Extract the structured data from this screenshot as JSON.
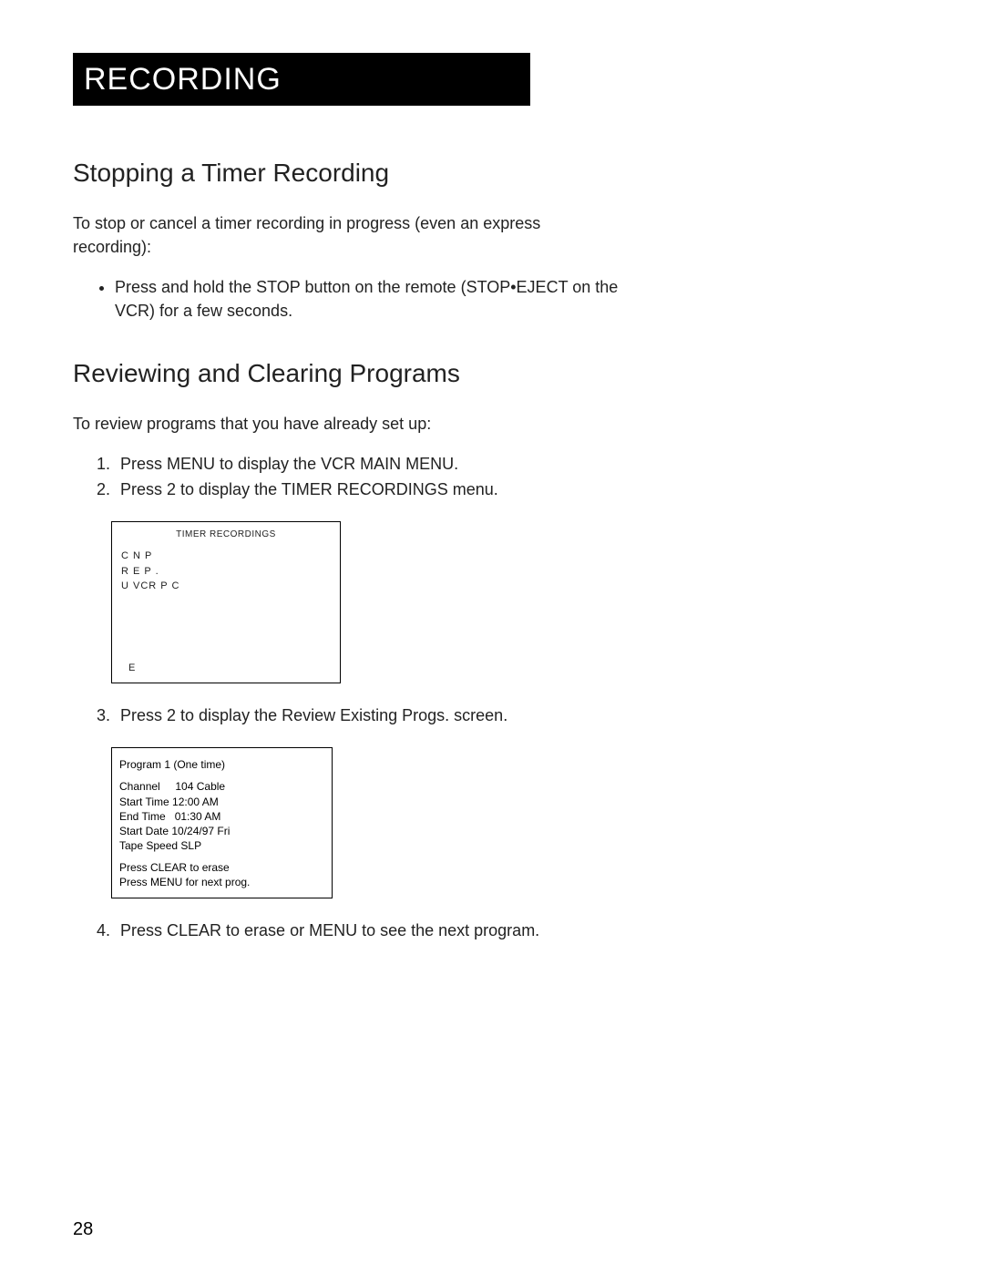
{
  "header": {
    "title": "RECORDING"
  },
  "section1": {
    "title": "Stopping a Timer Recording",
    "intro": "To stop or cancel a timer recording in progress (even an express recording):",
    "bullet1": "Press and hold the STOP button on the remote (STOP•EJECT on the VCR) for a few seconds."
  },
  "section2": {
    "title": "Reviewing and Clearing Programs",
    "intro": "To review programs that you have already set up:",
    "step1": "Press MENU to display the VCR MAIN MENU.",
    "step2": "Press 2 to display the TIMER RECORDINGS menu.",
    "step3": "Press 2 to display the Review Existing Progs. screen.",
    "step4": "Press CLEAR to erase or MENU to see the next program."
  },
  "timer_screen": {
    "title": "TIMER RECORDINGS",
    "line1": "C        N    P",
    "line2": "R         E         P      .",
    "line3": "U    VCR P       C",
    "lineE": "E"
  },
  "prog_screen": {
    "title": "Program 1 (One time)",
    "channel": "Channel     104 Cable",
    "start_time": "Start Time 12:00 AM",
    "end_time": "End Time   01:30 AM",
    "start_date": "Start Date 10/24/97 Fri",
    "tape_speed": "Tape Speed SLP",
    "clear": "Press CLEAR to erase",
    "menu": "Press MENU for next prog."
  },
  "page_number": "28"
}
